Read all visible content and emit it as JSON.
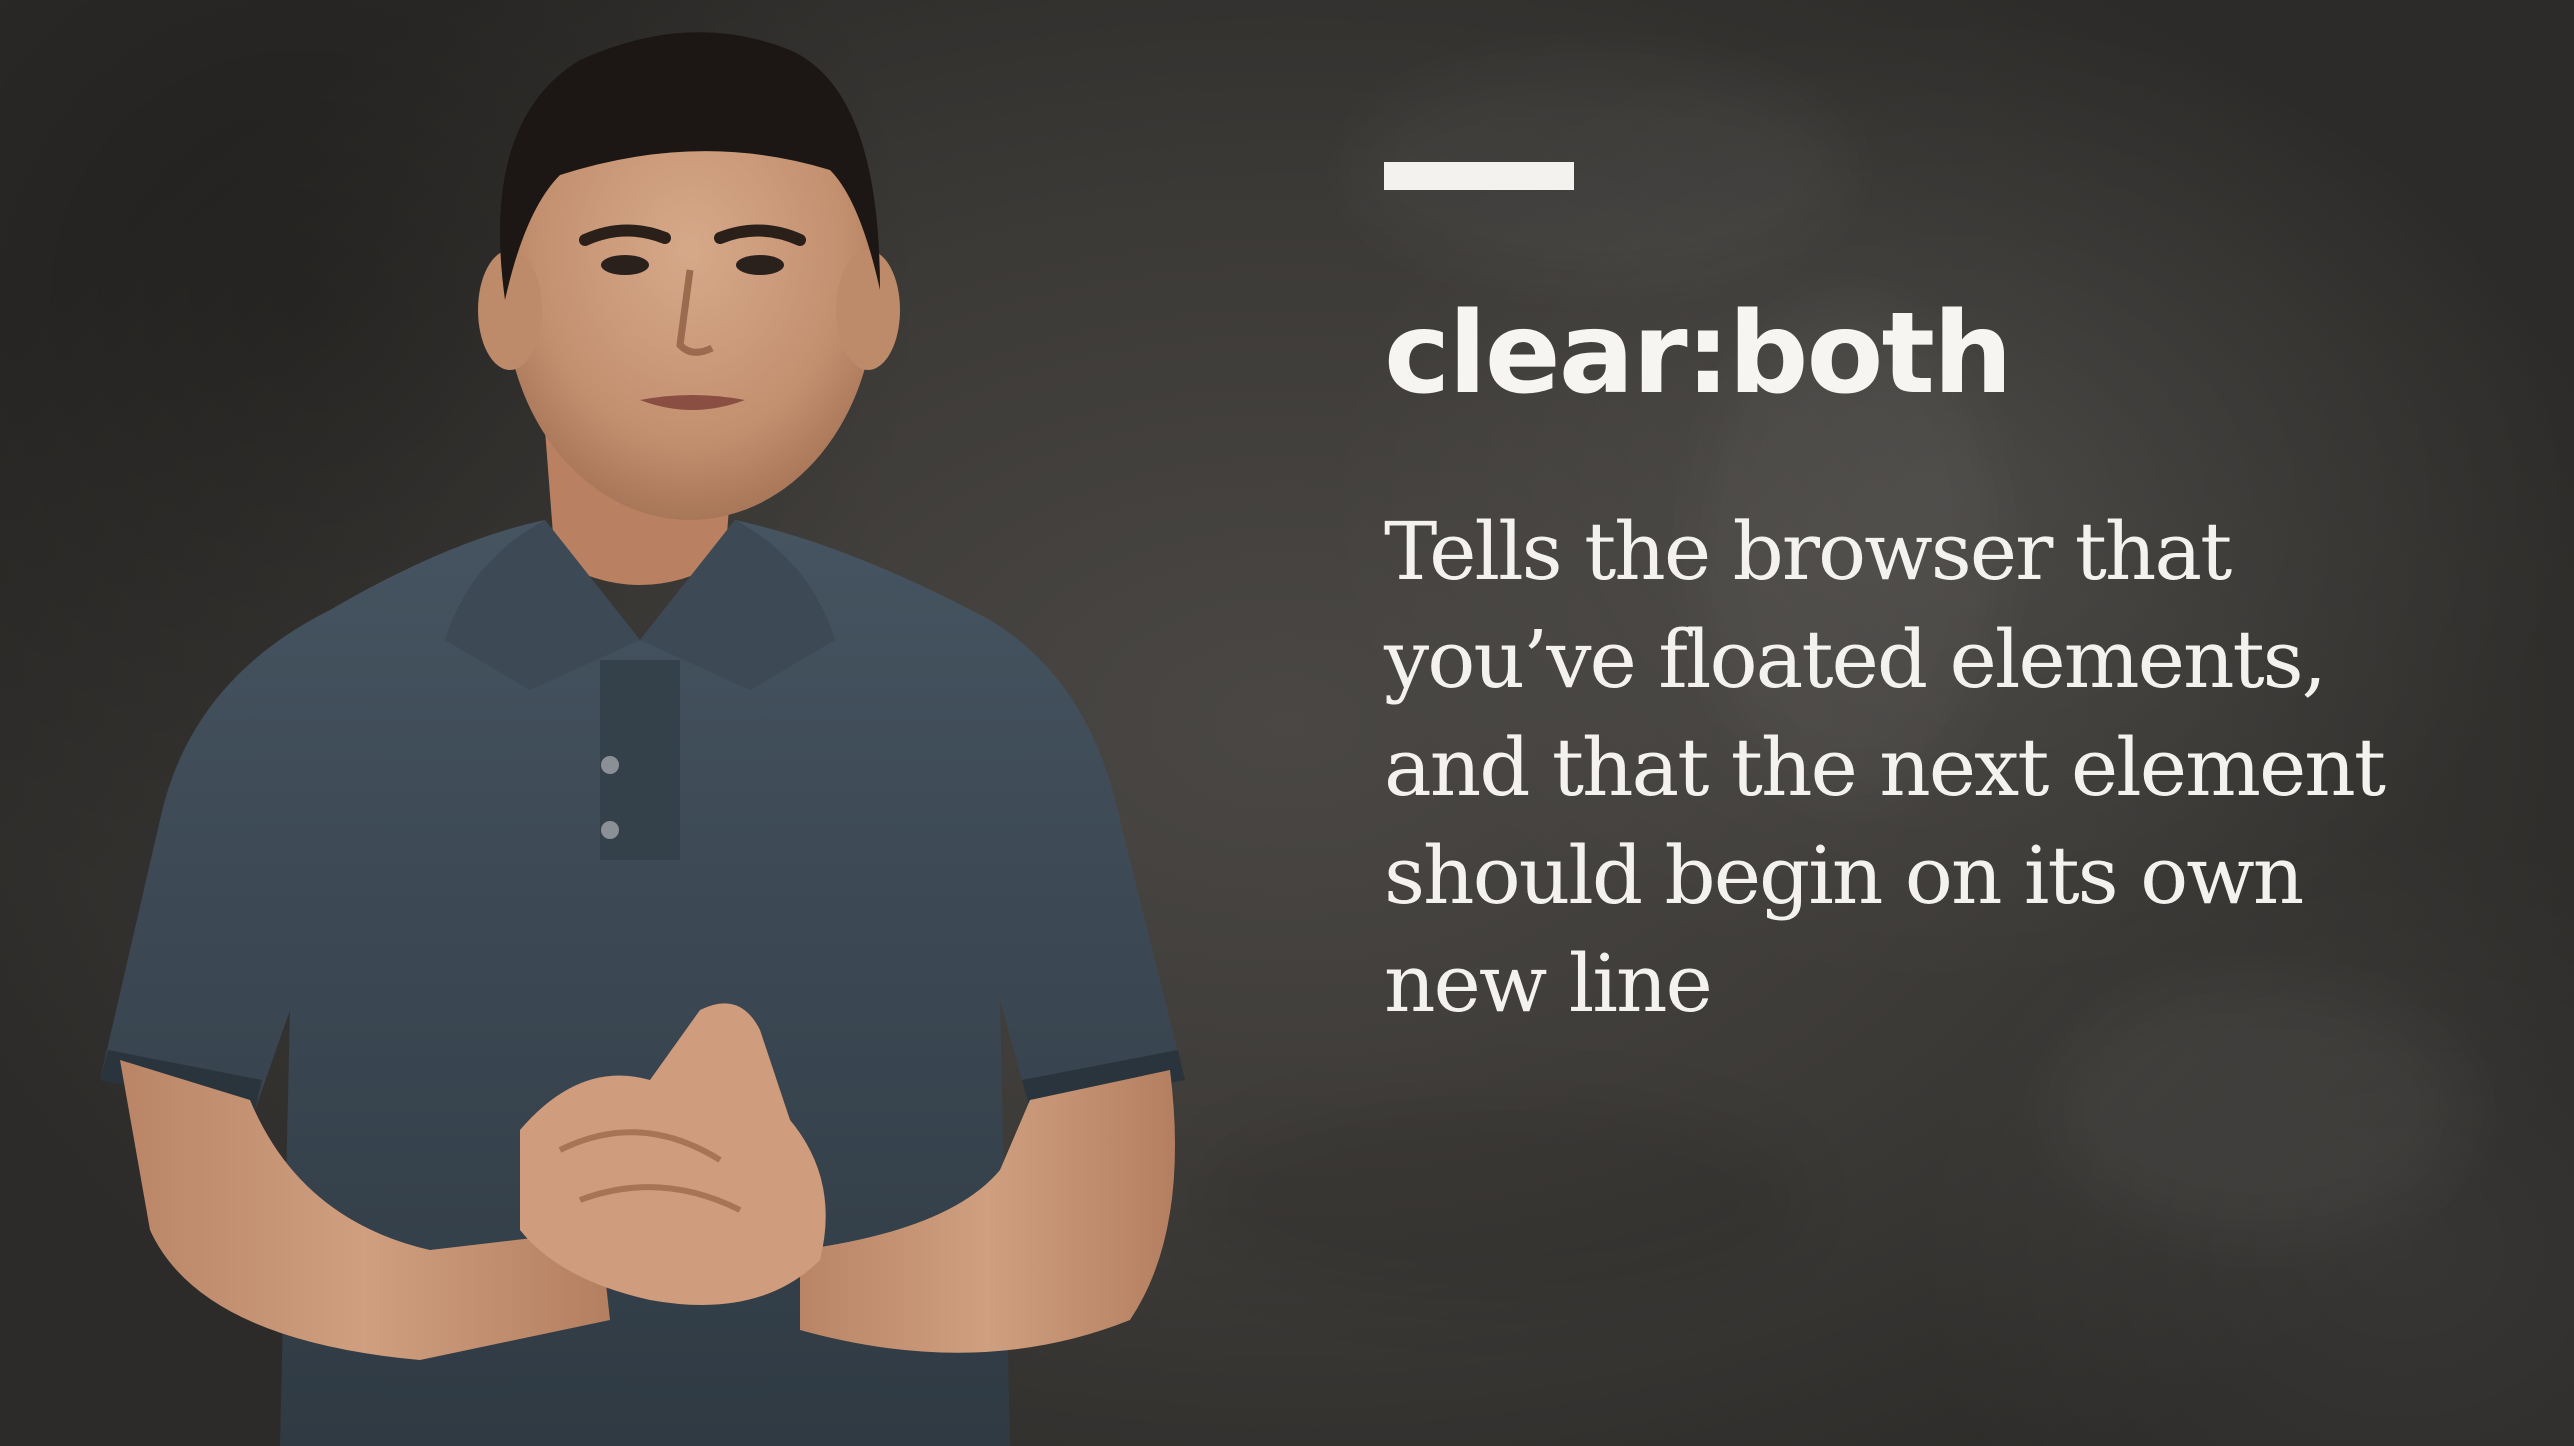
{
  "slide": {
    "heading": "clear:both",
    "description_lines": [
      "Tells the browser that",
      "you’ve floated elements,",
      "and that the next element",
      "should begin on its own",
      "new line"
    ]
  },
  "colors": {
    "background": "#3b3936",
    "text": "#f4f2ee",
    "shirt": "#3e4a54",
    "skin": "#c99a7c",
    "hair": "#1c1714"
  },
  "presenter": {
    "description": "person"
  }
}
